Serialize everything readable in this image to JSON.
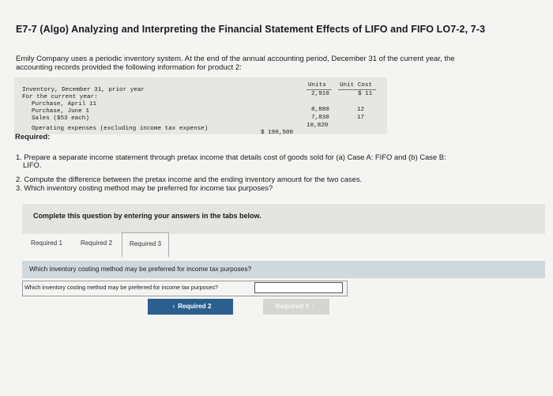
{
  "header": {
    "title": "E7-7 (Algo) Analyzing and Interpreting the Financial Statement Effects of LIFO and FIFO LO7-2, 7-3"
  },
  "intro": {
    "line1": "Emily Company uses a periodic inventory system. At the end of the annual accounting period, December 31 of the current year, the",
    "line2": "accounting records provided the following information for product 2:"
  },
  "table": {
    "col_units": "Units",
    "col_unit_cost": "Unit Cost",
    "rows": {
      "inventory": {
        "label": "Inventory, December 31, prior year",
        "units": "2,910",
        "cost": "$ 11"
      },
      "current_year": {
        "label": "For the current year:"
      },
      "purchase_april": {
        "label": "Purchase, April 11",
        "units": "8,880",
        "cost": "12"
      },
      "purchase_june": {
        "label": "Purchase, June 1",
        "units": "7,830",
        "cost": "17"
      },
      "sales": {
        "label": "Sales ($53 each)",
        "units": "10,820"
      },
      "operating": {
        "label": "Operating expenses (excluding income tax expense)",
        "amount": "$ 190,500"
      }
    }
  },
  "required": {
    "heading": "Required:",
    "q1_line1": "1. Prepare a separate income statement through pretax income that details cost of goods sold for (a) Case A: FIFO and (b) Case B:",
    "q1_line2": "LIFO.",
    "q2": "2. Compute the difference between the pretax income and the ending inventory amount for the two cases.",
    "q3": "3. Which inventory costing method may be preferred for income tax purposes?"
  },
  "instructions": "Complete this question by entering your answers in the tabs below.",
  "tabs": [
    {
      "label": "Required 1"
    },
    {
      "label": "Required 2"
    },
    {
      "label": "Required 3"
    }
  ],
  "question": "Which inventory costing method may be preferred for income tax purposes?",
  "answer": {
    "label": "Which inventory costing method may be preferred for income tax purposes?",
    "value": ""
  },
  "nav": {
    "prev_label": "Required 2",
    "next_label": "Required 3"
  }
}
